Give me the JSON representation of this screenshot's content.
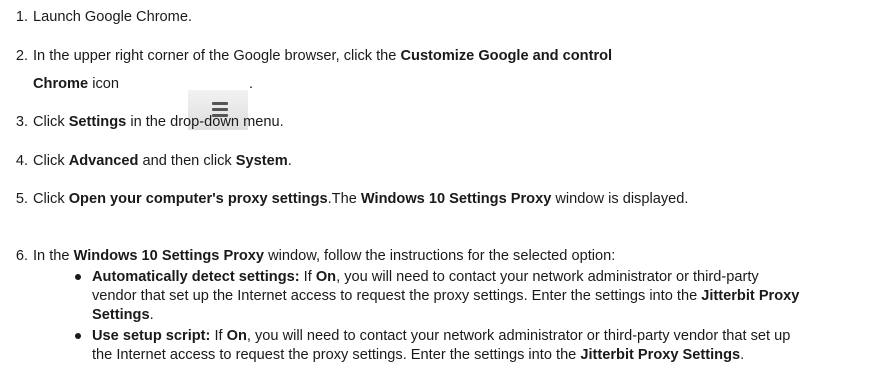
{
  "steps": [
    {
      "num": "1.",
      "text": "Launch Google Chrome."
    },
    {
      "num": "2.",
      "pre": "In the upper right corner of the Google browser, click the ",
      "bold1": "Customize Google  and control",
      "bold2": "Chrome",
      "post": " icon",
      "end": "."
    },
    {
      "num": "3.",
      "pre": "Click ",
      "bold": "Settings",
      "post": " in the drop-down menu."
    },
    {
      "num": "4.",
      "pre": "Click ",
      "bold1": "Advanced",
      "mid": " and then click ",
      "bold2": "System",
      "end": "."
    },
    {
      "num": "5.",
      "pre": "Click ",
      "bold1": "Open your computer's proxy settings",
      "mid": ".The ",
      "bold2": "Windows 10 Settings Proxy",
      "post": " window is displayed."
    },
    {
      "num": "6.",
      "pre": "In the ",
      "bold": "Windows 10 Settings Proxy",
      "post": " window, follow the instructions for the selected option:"
    }
  ],
  "bullets": [
    {
      "term": "Automatically detect settings:",
      "pre": " If ",
      "on": "On",
      "post": ", you will need to contact your network administrator or third-party vendor that set up the Internet access to request the proxy settings. Enter the settings into the ",
      "target": "Jitterbit Proxy Settings",
      "end": "."
    },
    {
      "term": "Use setup script:",
      "pre": " If ",
      "on": "On",
      "post": ", you will need to contact your network administrator or third-party vendor that set up the Internet access to request the proxy settings. Enter the settings into the ",
      "target": "Jitterbit Proxy Settings",
      "end": "."
    }
  ],
  "icon": "hamburger-menu-icon"
}
